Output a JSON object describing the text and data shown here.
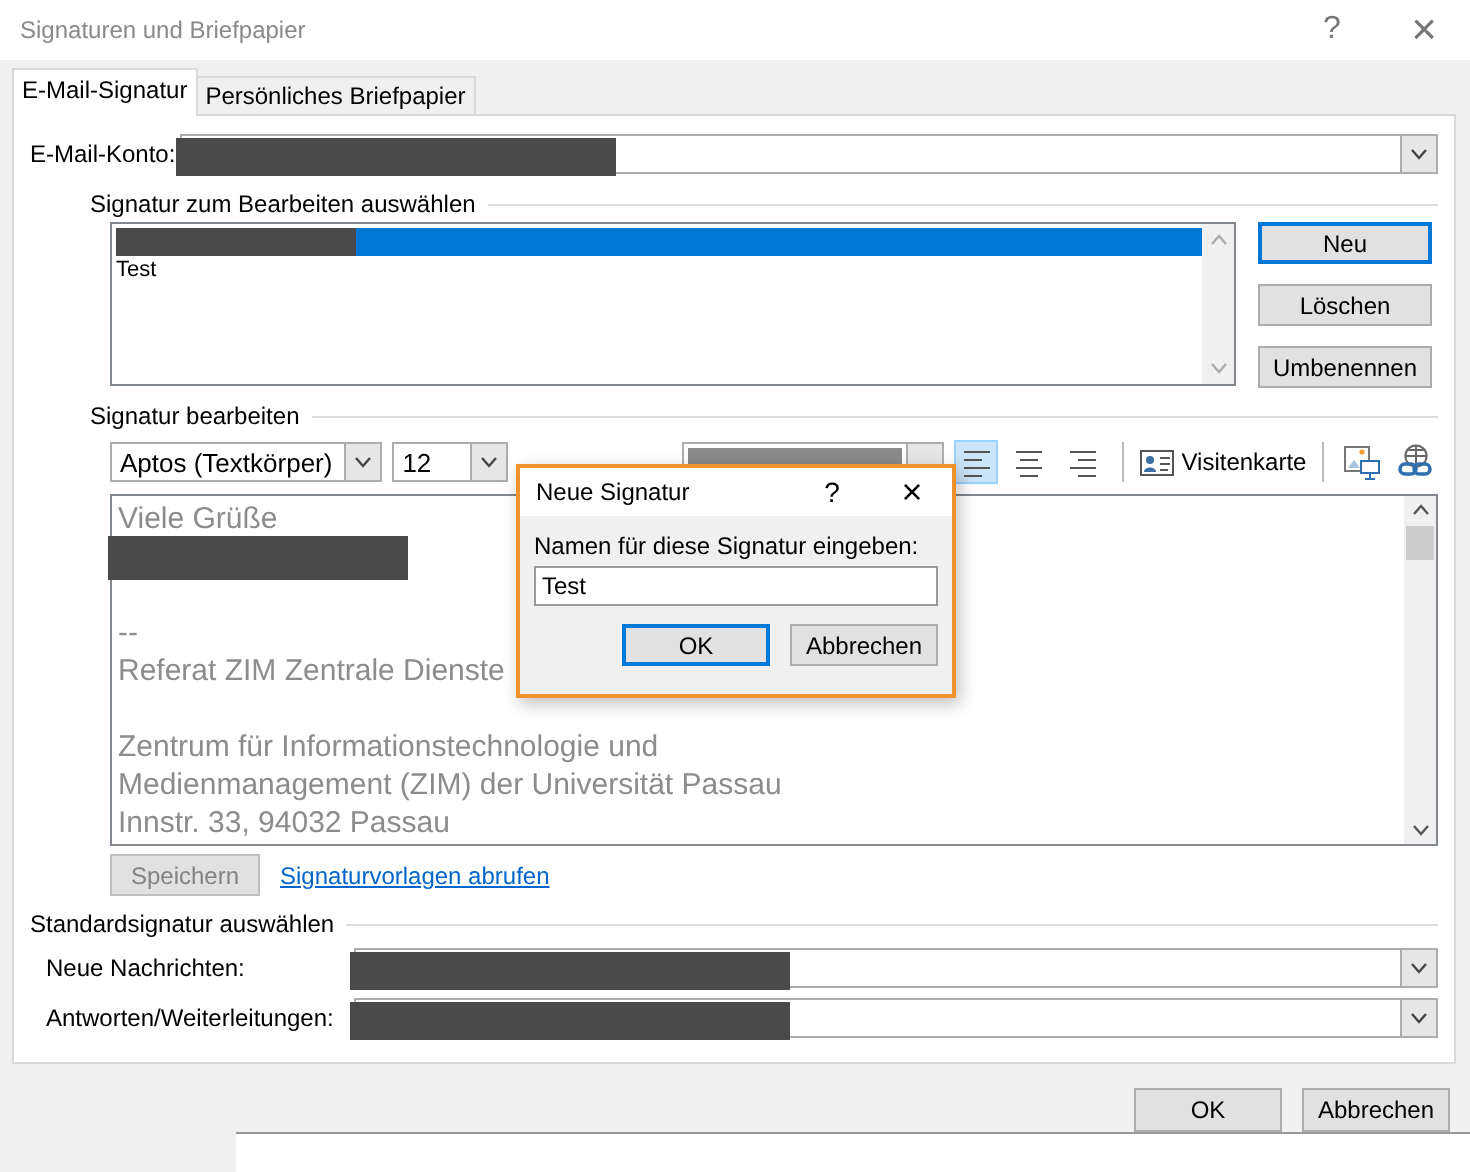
{
  "window": {
    "title": "Signaturen und Briefpapier",
    "help": "?",
    "close": "×"
  },
  "tabs": [
    {
      "label": "E-Mail-Signatur",
      "selected": true
    },
    {
      "label": "Persönliches Briefpapier",
      "selected": false
    }
  ],
  "account": {
    "label": "E-Mail-Konto:",
    "redacted": true
  },
  "select_group": {
    "title": "Signatur zum Bearbeiten auswählen",
    "items": [
      {
        "redacted": true,
        "selected": true
      },
      {
        "label": "Test",
        "redacted": false,
        "selected": false
      }
    ],
    "buttons": [
      "Neu",
      "Löschen",
      "Umbenennen"
    ]
  },
  "edit_group": {
    "title": "Signatur bearbeiten",
    "font": "Aptos (Textkörper)",
    "size": "12",
    "align_buttons": [
      {
        "kind": "left",
        "selected": true
      },
      {
        "kind": "center",
        "selected": false
      },
      {
        "kind": "right",
        "selected": false
      }
    ],
    "business_card": "Visitenkarte",
    "lines": [
      {
        "kind": "text",
        "text": "Viele Grüße"
      },
      {
        "kind": "redacted"
      },
      {
        "kind": "blank"
      },
      {
        "kind": "text",
        "text": "--"
      },
      {
        "kind": "text",
        "text": "Referat ZIM Zentrale Dienste"
      },
      {
        "kind": "blank"
      },
      {
        "kind": "text",
        "text": "Zentrum für Informationstechnologie und"
      },
      {
        "kind": "text",
        "text": "Medienmanagement (ZIM) der Universität Passau"
      },
      {
        "kind": "text",
        "text": "Innstr. 33, 94032 Passau"
      }
    ],
    "save": {
      "label": "Speichern",
      "disabled": true
    },
    "link": "Signaturvorlagen abrufen"
  },
  "default_group": {
    "title": "Standardsignatur auswählen",
    "rows": [
      {
        "label": "Neue Nachrichten:",
        "redacted": true
      },
      {
        "label": "Antworten/Weiterleitungen:",
        "redacted": true
      }
    ]
  },
  "buttons": [
    {
      "label": "OK"
    },
    {
      "label": "Abbrechen"
    }
  ],
  "modal": {
    "title": "Neue Signatur",
    "help": "?",
    "close": "×",
    "prompt": "Namen für diese Signatur eingeben:",
    "value": "Test",
    "buttons": [
      {
        "label": "OK",
        "selected": true
      },
      {
        "label": "Abbrechen",
        "selected": false
      }
    ]
  }
}
